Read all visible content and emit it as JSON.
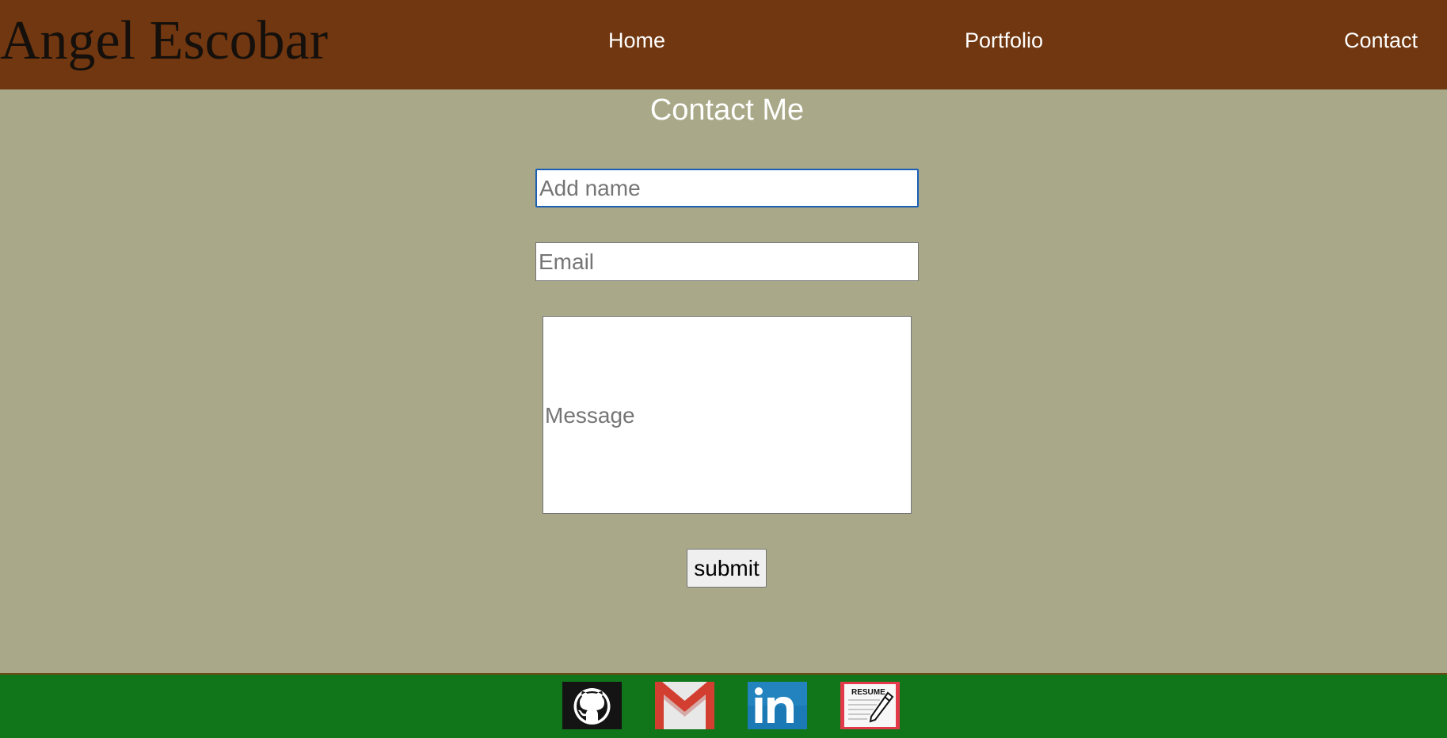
{
  "header": {
    "brand": "Angel Escobar",
    "nav": {
      "home": "Home",
      "portfolio": "Portfolio",
      "contact": "Contact"
    }
  },
  "main": {
    "title": "Contact Me",
    "form": {
      "name_placeholder": "Add name",
      "name_value": "",
      "email_placeholder": "Email",
      "email_value": "",
      "message_placeholder": "Message",
      "submit_label": "submit"
    }
  },
  "footer": {
    "links": [
      {
        "icon": "github-icon"
      },
      {
        "icon": "gmail-icon"
      },
      {
        "icon": "linkedin-icon"
      },
      {
        "icon": "resume-icon",
        "label": "RESUME"
      }
    ]
  },
  "colors": {
    "header_bg": "#713710",
    "page_bg": "#a9a989",
    "footer_bg": "#11761a",
    "focus_border": "#1a5fb4"
  }
}
